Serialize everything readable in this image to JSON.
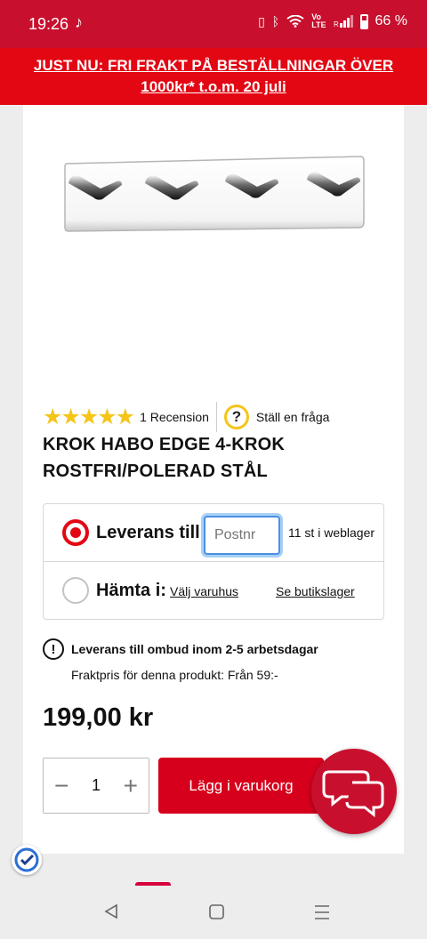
{
  "status_bar": {
    "time": "19:26",
    "battery": "66 %"
  },
  "promo": {
    "line1": "JUST NU: FRI FRAKT PÅ BESTÄLLNINGAR ÖVER",
    "line2": "1000kr* t.o.m. 20 juli"
  },
  "product": {
    "rating": 5,
    "stars": "★★★★★",
    "review_count": "1 Recension",
    "ask_question": "Ställ en fråga",
    "title_line1": "KROK HABO EDGE 4-KROK",
    "title_line2": "ROSTFRI/POLERAD STÅL",
    "price": "199,00 kr"
  },
  "delivery": {
    "deliver_label": "Leverans till:",
    "postnr_placeholder": "Postnr",
    "stock_text": "11 st i weblager",
    "pickup_label": "Hämta i:",
    "choose_store": "Välj varuhus",
    "see_stock": "Se butikslager",
    "info_text": "Leverans till ombud inom 2-5 arbetsdagar",
    "freight_text": "Fraktpris för denna produkt: Från 59:-"
  },
  "cart": {
    "quantity": "1",
    "minus": "−",
    "plus": "+",
    "add_label": "Lägg i varukorg"
  },
  "colors": {
    "brand_red": "#e30613",
    "status_red": "#c8102e",
    "star_yellow": "#f5c518"
  },
  "icons": [
    "tiktok-icon",
    "vibrate-icon",
    "bluetooth-icon",
    "wifi-icon",
    "signal-icon",
    "battery-icon",
    "question-icon",
    "info-icon",
    "chat-icon",
    "verified-badge-icon",
    "back-icon",
    "home-icon",
    "recents-icon"
  ]
}
